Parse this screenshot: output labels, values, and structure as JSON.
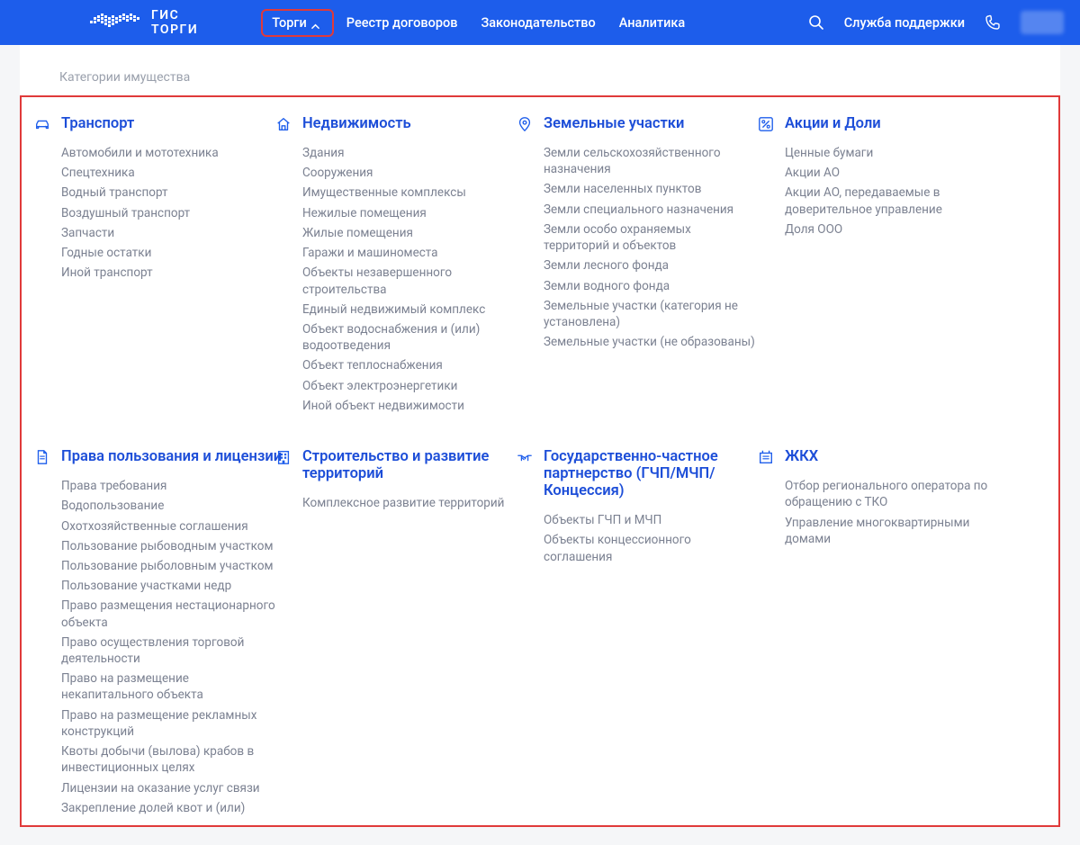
{
  "header": {
    "logo_line1": "ГИС",
    "logo_line2": "ТОРГИ",
    "nav": {
      "torgi": "Торги",
      "contracts": "Реестр договоров",
      "law": "Законодательство",
      "analytics": "Аналитика"
    },
    "support": "Служба поддержки"
  },
  "page_title": "Категории имущества",
  "categories": [
    {
      "title": "Транспорт",
      "items": [
        "Автомобили и мототехника",
        "Спецтехника",
        "Водный транспорт",
        "Воздушный транспорт",
        "Запчасти",
        "Годные остатки",
        "Иной транспорт"
      ]
    },
    {
      "title": "Недвижимость",
      "items": [
        "Здания",
        "Сооружения",
        "Имущественные комплексы",
        "Нежилые помещения",
        "Жилые помещения",
        "Гаражи и машиноместа",
        "Объекты незавершенного строительства",
        "Единый недвижимый комплекс",
        "Объект водоснабжения и (или) водоотведения",
        "Объект теплоснабжения",
        "Объект электроэнергетики",
        "Иной объект недвижимости"
      ]
    },
    {
      "title": "Земельные участки",
      "items": [
        "Земли сельскохозяйственного назначения",
        "Земли населенных пунктов",
        "Земли специального назначения",
        "Земли особо охраняемых территорий и объектов",
        "Земли лесного фонда",
        "Земли водного фонда",
        "Земельные участки (категория не установлена)",
        "Земельные участки (не образованы)"
      ]
    },
    {
      "title": "Акции и Доли",
      "items": [
        "Ценные бумаги",
        "Акции АО",
        "Акции АО, передаваемые в доверительное управление",
        "Доля ООО"
      ]
    },
    {
      "title": "Права пользования и лицензии",
      "items": [
        "Права требования",
        "Водопользование",
        "Охотхозяйственные соглашения",
        "Пользование рыбоводным участком",
        "Пользование рыболовным участком",
        "Пользование участками недр",
        "Право размещения нестационарного объекта",
        "Право осуществления торговой деятельности",
        "Право на размещение некапитального объекта",
        "Право на размещение рекламных конструкций",
        "Квоты добычи (вылова) крабов в инвестиционных целях",
        "Лицензии на оказание услуг связи",
        "Закрепление долей квот и (или)"
      ]
    },
    {
      "title": "Строительство и развитие территорий",
      "items": [
        "Комплексное развитие территорий"
      ]
    },
    {
      "title": "Государственно-частное партнерство (ГЧП/МЧП/Концессия)",
      "items": [
        "Объекты ГЧП и МЧП",
        "Объекты концессионного соглашения"
      ]
    },
    {
      "title": "ЖКХ",
      "items": [
        "Отбор регионального оператора по обращению с ТКО",
        "Управление многоквартирными домами"
      ]
    }
  ],
  "icons": [
    "car-icon",
    "house-icon",
    "pin-icon",
    "percent-icon",
    "document-icon",
    "building-icon",
    "handshake-icon",
    "utilities-icon"
  ]
}
